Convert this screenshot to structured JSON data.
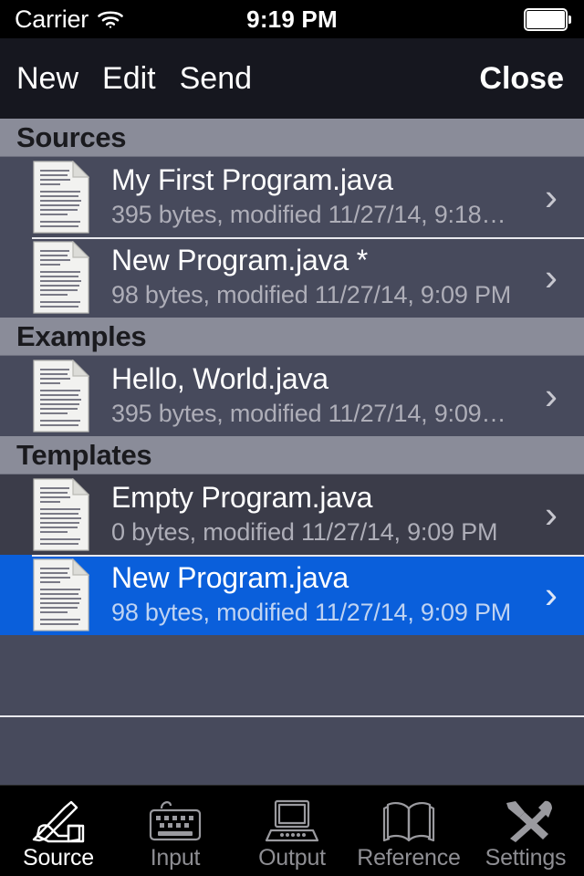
{
  "status_bar": {
    "carrier": "Carrier",
    "wifi_icon": "wifi-icon",
    "time": "9:19 PM",
    "battery_icon": "battery-full-icon"
  },
  "navbar": {
    "new_label": "New",
    "edit_label": "Edit",
    "send_label": "Send",
    "close_label": "Close"
  },
  "sections": [
    {
      "title": "Sources",
      "rows": [
        {
          "icon": "document-icon",
          "title": "My First Program.java",
          "subtitle": "395 bytes, modified 11/27/14, 9:18…",
          "accessory": "chevron-right-icon",
          "state": "normal"
        },
        {
          "icon": "document-icon",
          "title": "New Program.java *",
          "subtitle": "98 bytes, modified 11/27/14, 9:09 PM",
          "accessory": "chevron-right-icon",
          "state": "normal"
        }
      ]
    },
    {
      "title": "Examples",
      "rows": [
        {
          "icon": "document-icon",
          "title": "Hello, World.java",
          "subtitle": "395 bytes, modified 11/27/14, 9:09…",
          "accessory": "chevron-right-icon",
          "state": "normal"
        }
      ]
    },
    {
      "title": "Templates",
      "rows": [
        {
          "icon": "document-icon",
          "title": "Empty Program.java",
          "subtitle": "0 bytes, modified 11/27/14, 9:09 PM",
          "accessory": "chevron-right-icon",
          "state": "pressed"
        },
        {
          "icon": "document-icon",
          "title": "New Program.java",
          "subtitle": "98 bytes, modified 11/27/14, 9:09 PM",
          "accessory": "chevron-right-icon",
          "state": "selected"
        }
      ]
    }
  ],
  "tabbar": {
    "items": [
      {
        "label": "Source",
        "icon": "hand-pen-icon",
        "active": true
      },
      {
        "label": "Input",
        "icon": "keyboard-icon",
        "active": false
      },
      {
        "label": "Output",
        "icon": "laptop-icon",
        "active": false
      },
      {
        "label": "Reference",
        "icon": "open-book-icon",
        "active": false
      },
      {
        "label": "Settings",
        "icon": "tools-icon",
        "active": false
      }
    ]
  },
  "colors": {
    "status_bar_bg": "#000000",
    "navbar_bg": "#16171F",
    "row_bg": "#474A5C",
    "row_pressed_bg": "#3B3C49",
    "selection_blue": "#0A5FDB",
    "section_header_bg": "#8A8C99",
    "tabbar_bg": "#000000",
    "tab_inactive": "#8E8E93",
    "tab_active": "#FFFFFF",
    "subtitle_gray": "#AEAEB8"
  },
  "chevron_glyph": "›"
}
